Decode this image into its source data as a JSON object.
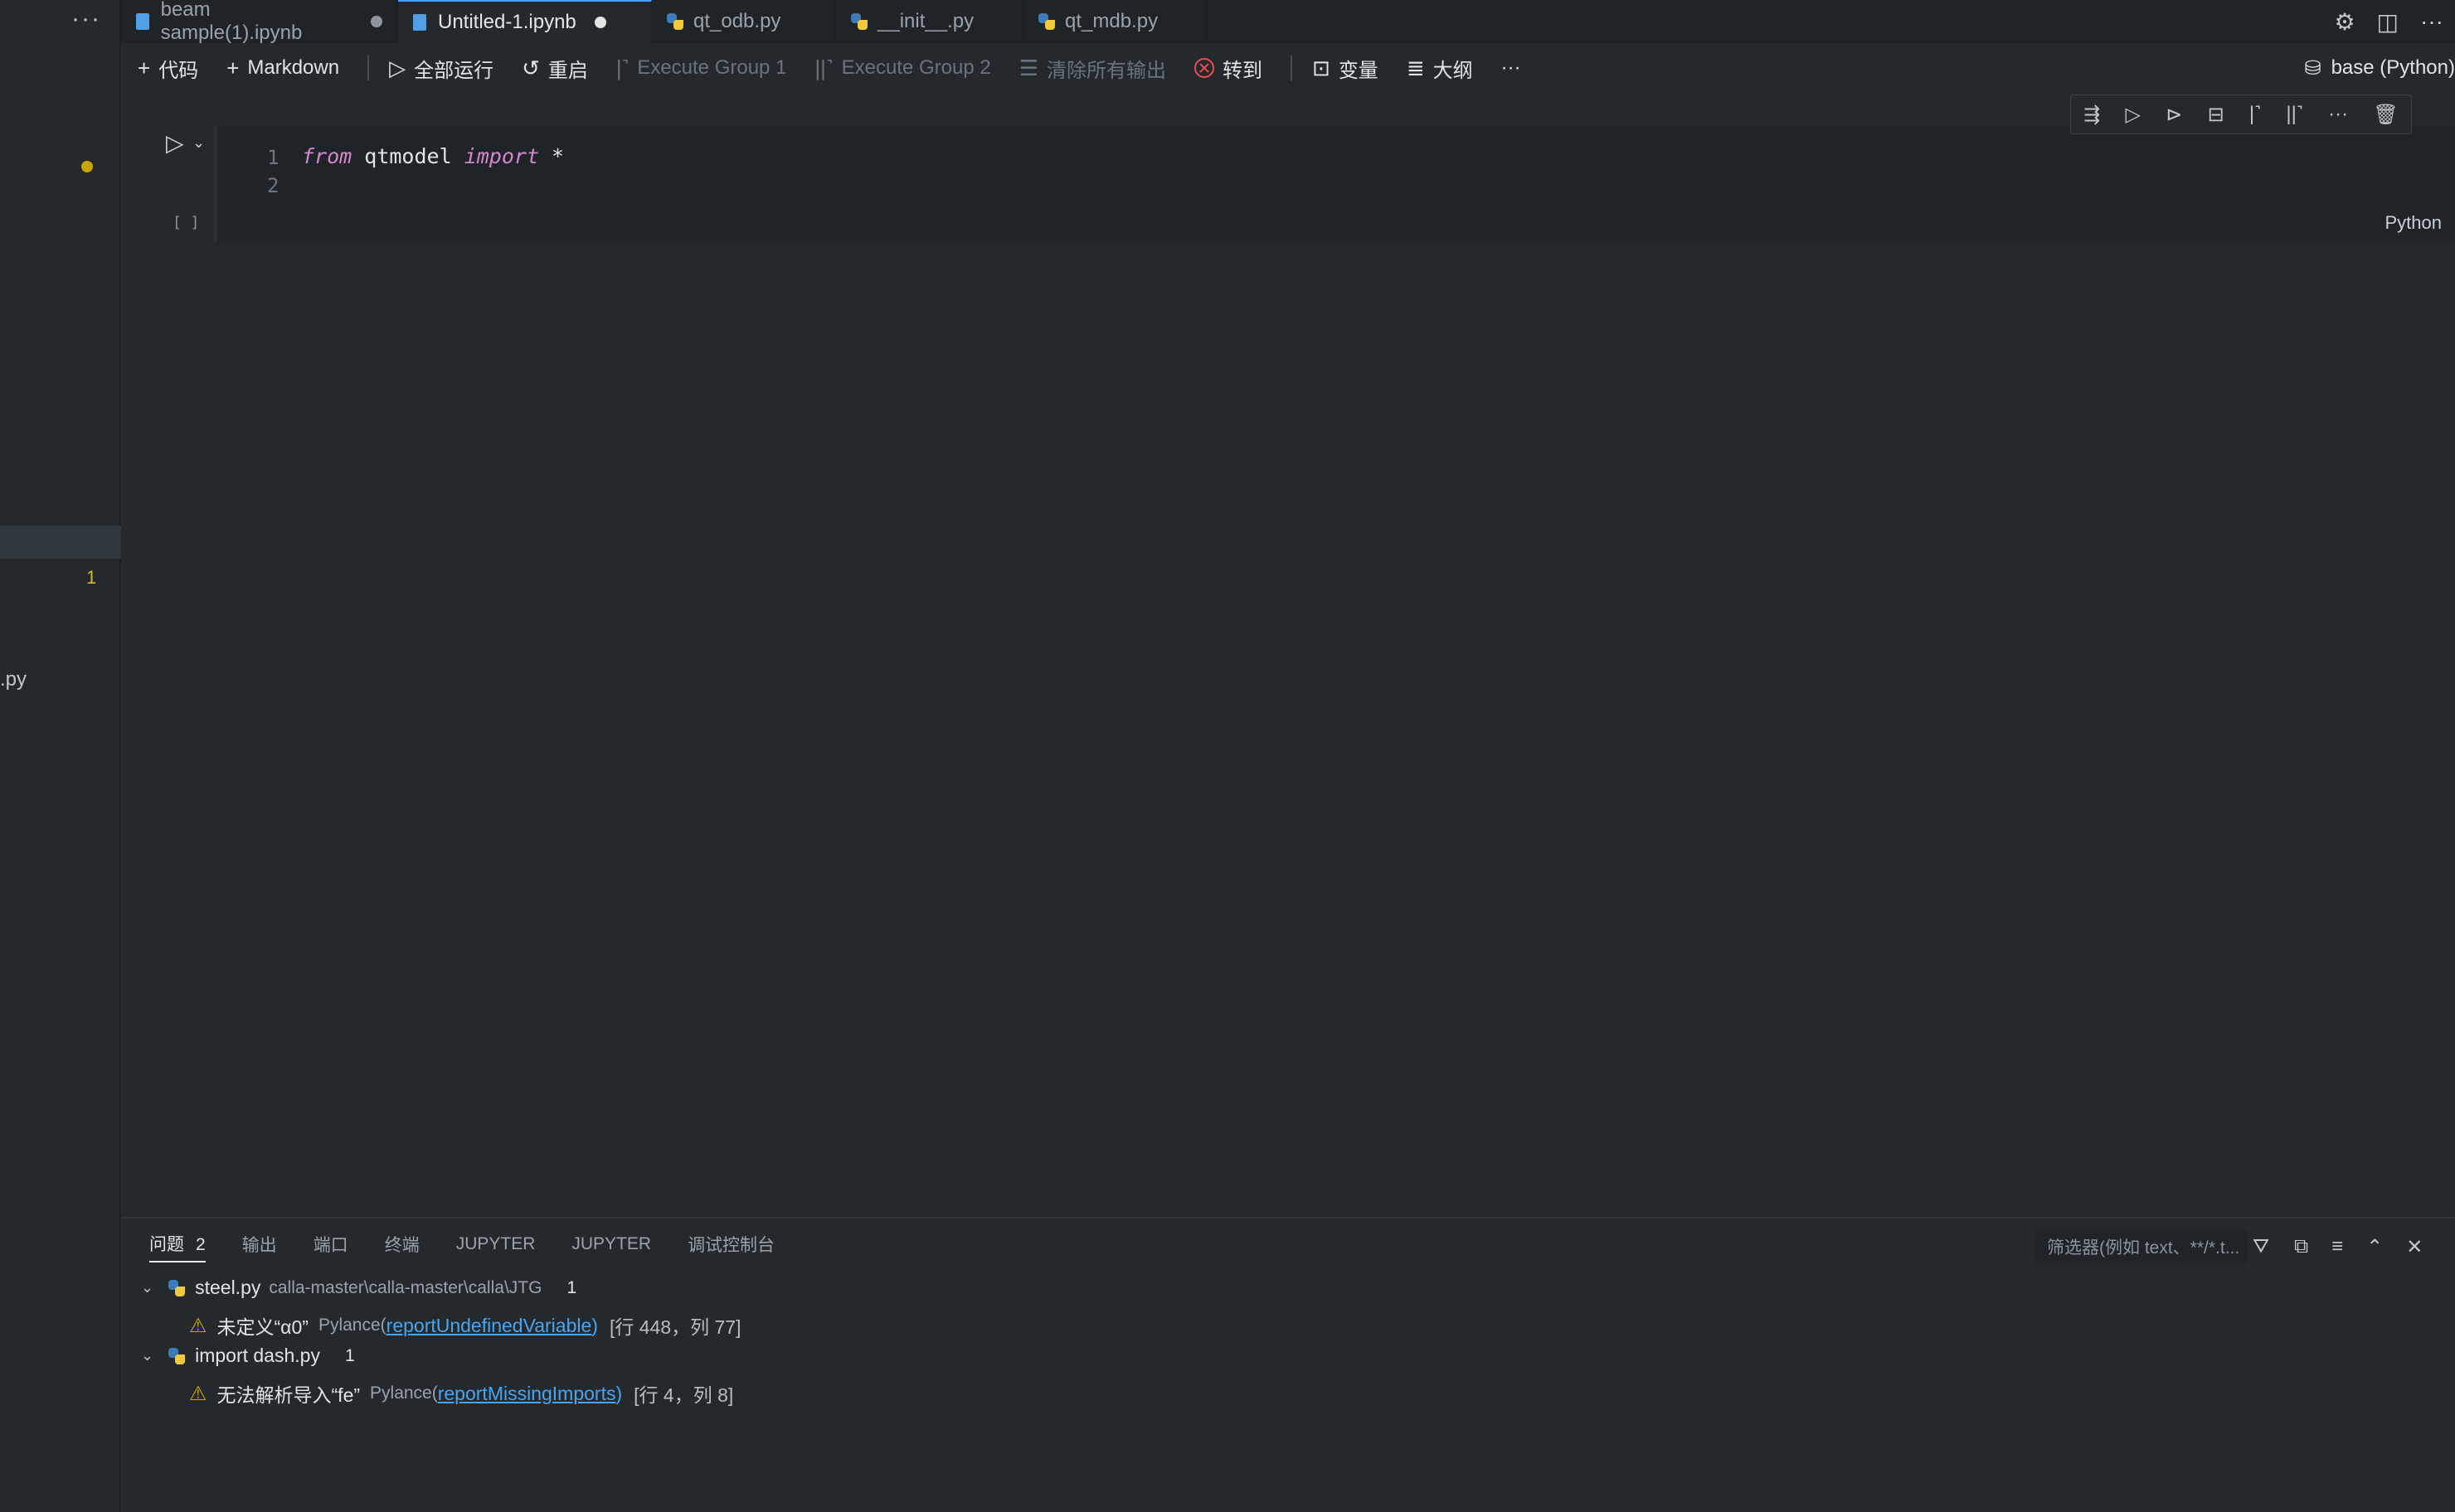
{
  "left": {
    "overflow_label": "···",
    "problem_count": "1",
    "file_fragment": ".py"
  },
  "tabs": [
    {
      "label": "beam sample(1).ipynb",
      "type": "notebook",
      "dirty": true,
      "active": false
    },
    {
      "label": "Untitled-1.ipynb",
      "type": "notebook",
      "dirty": true,
      "active": true
    },
    {
      "label": "qt_odb.py",
      "type": "python",
      "dirty": false,
      "active": false
    },
    {
      "label": "__init__.py",
      "type": "python",
      "dirty": false,
      "active": false
    },
    {
      "label": "qt_mdb.py",
      "type": "python",
      "dirty": false,
      "active": false
    }
  ],
  "top_right": {
    "settings": "⚙",
    "split": "◫",
    "more": "···"
  },
  "toolbar": {
    "add_code": "代码",
    "add_markdown": "Markdown",
    "run_all": "全部运行",
    "restart": "重启",
    "execute_group_1": "Execute Group 1",
    "execute_group_2": "Execute Group 2",
    "clear_outputs": "清除所有输出",
    "goto": "转到",
    "variables": "变量",
    "outline": "大纲",
    "more": "···",
    "kernel": "base (Python)"
  },
  "cell": {
    "line_numbers": [
      "1",
      "2"
    ],
    "code": {
      "kw1": "from",
      "module": " qtmodel ",
      "kw2": "import",
      "rest": " *"
    },
    "exec_count": "[ ]",
    "language": "Python"
  },
  "panel": {
    "tabs": [
      {
        "label": "问题",
        "badge": "2",
        "active": true
      },
      {
        "label": "输出",
        "active": false
      },
      {
        "label": "端口",
        "active": false
      },
      {
        "label": "终端",
        "active": false
      },
      {
        "label": "JUPYTER",
        "active": false
      },
      {
        "label": "JUPYTER",
        "active": false
      },
      {
        "label": "调试控制台",
        "active": false
      }
    ],
    "filter_placeholder": "筛选器(例如 text、**/*.t...",
    "problems": [
      {
        "file": "steel.py",
        "path": "calla-master\\calla-master\\calla\\JTG",
        "count": "1",
        "message": "未定义“α0”",
        "source": "Pylance",
        "code": "reportUndefinedVariable",
        "location": "[行 448，列 77]"
      },
      {
        "file": "import dash.py",
        "path": "",
        "count": "1",
        "message": "无法解析导入“fe”",
        "source": "Pylance",
        "code": "reportMissingImports",
        "location": "[行 4，列 8]"
      }
    ]
  },
  "colors": {
    "accent": "#4a9eff",
    "warning": "#cca700",
    "error": "#f14c4c",
    "keyword": "#d785d0"
  }
}
